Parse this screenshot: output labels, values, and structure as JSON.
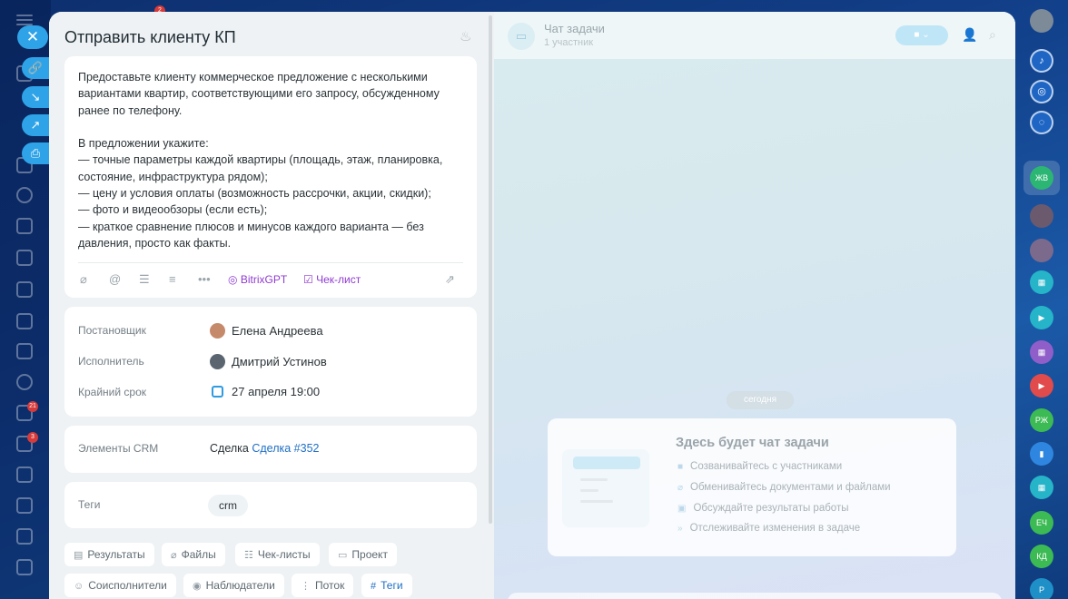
{
  "task": {
    "title": "Отправить клиенту КП",
    "description": "Предоставьте клиенту коммерческое предложение с несколькими вариантами квартир, соответствующими его запросу, обсужденному ранее по телефону.\n\nВ предложении укажите:\n— точные параметры каждой квартиры (площадь, этаж, планировка, состояние, инфраструктура рядом);\n— цену и условия оплаты (возможность рассрочки, акции, скидки);\n— фото и видеообзоры (если есть);\n— краткое сравнение плюсов и минусов каждого варианта — без давления, просто как факты.",
    "toolbar": {
      "gpt_label": "BitrixGPT",
      "checklist_label": "Чек-лист"
    },
    "fields": {
      "creator_label": "Постановщик",
      "creator_value": "Елена Андреева",
      "assignee_label": "Исполнитель",
      "assignee_value": "Дмитрий Устинов",
      "deadline_label": "Крайний срок",
      "deadline_value": "27 апреля 19:00"
    },
    "crm": {
      "label": "Элементы CRM",
      "prefix": "Сделка",
      "link": "Сделка #352"
    },
    "tags": {
      "label": "Теги",
      "value": "crm"
    },
    "chips": {
      "results": "Результаты",
      "files": "Файлы",
      "checklists": "Чек-листы",
      "project": "Проект",
      "coexecutors": "Соисполнители",
      "observers": "Наблюдатели",
      "flow": "Поток",
      "tags": "Теги"
    }
  },
  "chat": {
    "title": "Чат задачи",
    "subtitle": "1 участник",
    "date_divider": "сегодня",
    "empty": {
      "title": "Здесь будет чат задачи",
      "items": [
        "Созванивайтесь с участниками",
        "Обменивайтесь документами и файлами",
        "Обсуждайте результаты работы",
        "Отслеживайте изменения в задаче"
      ]
    }
  },
  "right_rail": {
    "initials": [
      "ЖВ",
      "РЖ",
      "ЕЧ",
      "КД",
      "Р"
    ]
  },
  "left_rail": {
    "badges": [
      "2",
      "21",
      "3"
    ]
  },
  "colors": {
    "accent": "#2fa3e8",
    "link": "#1f6fc4",
    "gpt": "#8f3bd1"
  }
}
